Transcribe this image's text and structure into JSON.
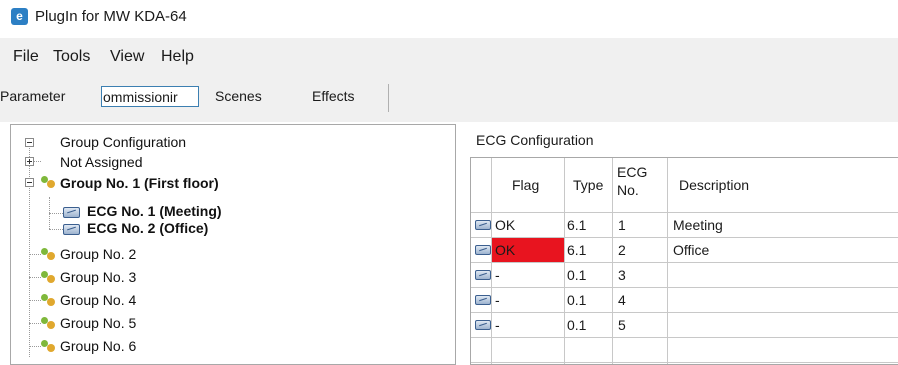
{
  "window": {
    "title": "PlugIn for MW KDA-64",
    "icon": "app-e-icon"
  },
  "menu": {
    "items": [
      "File",
      "Tools",
      "View",
      "Help"
    ]
  },
  "tabs": {
    "items": [
      "Parameter",
      "ommissionir",
      "Scenes",
      "Effects"
    ],
    "active_index": 1
  },
  "tree": {
    "root": "Group Configuration",
    "not_assigned": "Not Assigned",
    "group1": "Group No. 1 (First floor)",
    "ecg1": "ECG No. 1 (Meeting)",
    "ecg2": "ECG No. 2 (Office)",
    "groups": [
      "Group No. 2",
      "Group No. 3",
      "Group No. 4",
      "Group No. 5",
      "Group No. 6"
    ]
  },
  "ecg_config": {
    "title": "ECG Configuration",
    "columns": {
      "flag": "Flag",
      "type": "Type",
      "ecg_no_line1": "ECG",
      "ecg_no_line2": "No.",
      "description": "Description"
    },
    "rows": [
      {
        "flag": "OK",
        "type": "6.1",
        "ecg_no": "1",
        "description": "Meeting",
        "flag_color": ""
      },
      {
        "flag": "OK",
        "type": "6.1",
        "ecg_no": "2",
        "description": "Office",
        "flag_color": "#e8141f"
      },
      {
        "flag": "-",
        "type": "0.1",
        "ecg_no": "3",
        "description": "",
        "flag_color": ""
      },
      {
        "flag": "-",
        "type": "0.1",
        "ecg_no": "4",
        "description": "",
        "flag_color": ""
      },
      {
        "flag": "-",
        "type": "0.1",
        "ecg_no": "5",
        "description": "",
        "flag_color": ""
      }
    ]
  },
  "colors": {
    "accent": "#3c7fb1",
    "error": "#e8141f",
    "chrome": "#f0f0f0"
  }
}
